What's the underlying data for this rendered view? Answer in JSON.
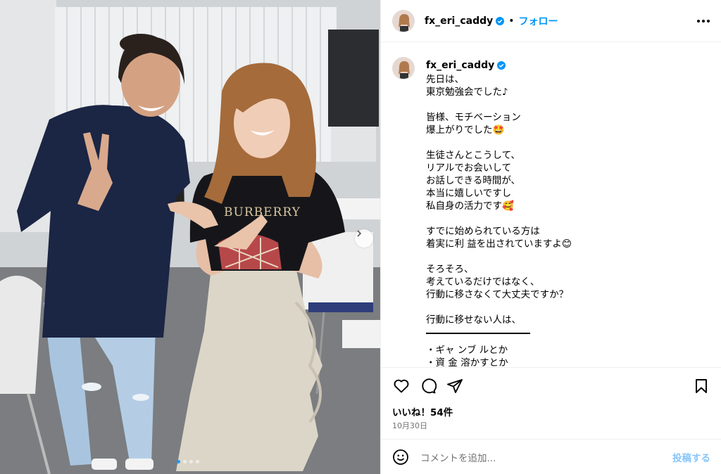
{
  "post": {
    "username": "fx_eri_caddy",
    "separator": "•",
    "follow_label": "フォロー",
    "caption": "先日は、\n東京勉強会でした♪\n\n皆様、モチベーション\n爆上がりでした🤩\n\n生徒さんとこうして、\nリアルでお会いして\nお話しできる時間が、\n本当に嬉しいですし\n私自身の活力です🥰\n\nすでに始められている方は\n着実に利 益を出されていますよ😊\n\nそろそろ、\n考えているだけではなく、\n行動に移さなくて大丈夫ですか？\n\n行動に移せない人は、",
    "caption_list": "・ギャ ンブ ルとか\n・資 金 溶かすとか\n・FXは大 金 が必要とか",
    "likes": "いいね！54件",
    "date": "10月30日",
    "comment_placeholder": "コメントを追加...",
    "post_label": "投稿する"
  },
  "photo": {
    "shirt_text": "BURBERRY",
    "slide_count": 4,
    "active_slide": 1
  },
  "icons": {
    "verified": "verified-badge-icon",
    "more": "more-options-icon",
    "like": "heart-icon",
    "comment": "comment-icon",
    "share": "share-icon",
    "save": "bookmark-icon",
    "emoji": "emoji-icon",
    "next": "chevron-right-icon"
  },
  "colors": {
    "accent": "#0095f6",
    "post_disabled": "#87c5f8",
    "muted": "#737373",
    "border": "#efefef"
  }
}
